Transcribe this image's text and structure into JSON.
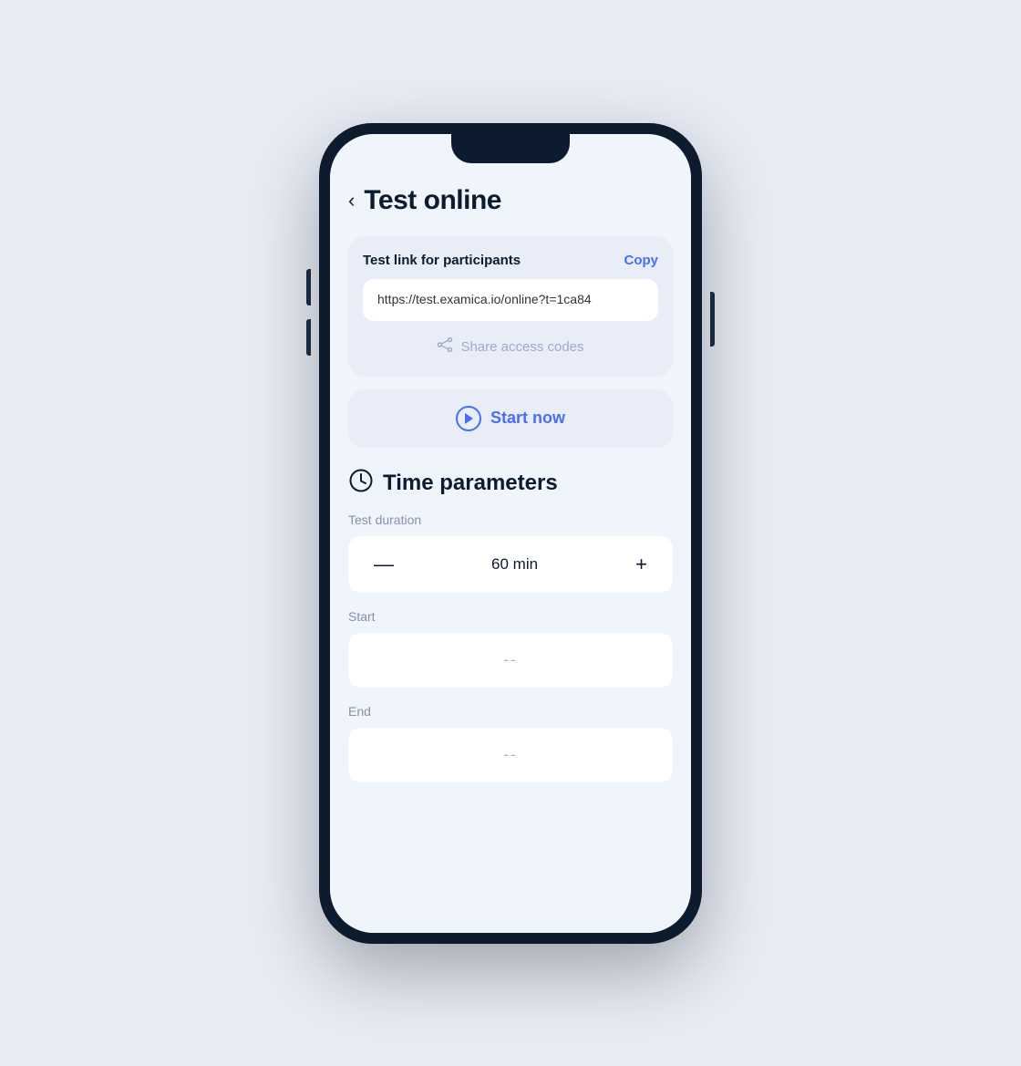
{
  "page": {
    "title": "Test online",
    "back_label": "<"
  },
  "test_link_card": {
    "label": "Test link for participants",
    "copy_button": "Copy",
    "link_url": "https://test.examica.io/online?t=1ca84",
    "share_codes_label": "Share access codes"
  },
  "start_now_button": {
    "label": "Start now"
  },
  "time_parameters": {
    "section_title": "Time parameters",
    "duration_label": "Test duration",
    "duration_value": "60 min",
    "start_label": "Start",
    "start_placeholder": "--",
    "end_label": "End",
    "end_placeholder": "--"
  },
  "icons": {
    "back": "‹",
    "clock": "⊙",
    "minus": "—",
    "plus": "+"
  }
}
